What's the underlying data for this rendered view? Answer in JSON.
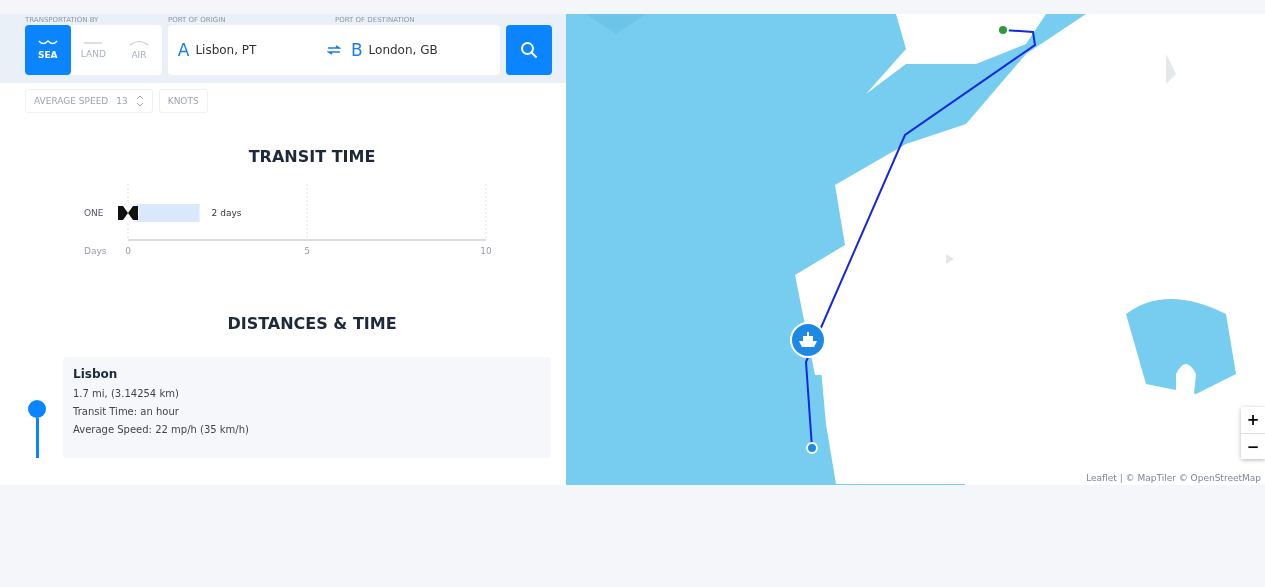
{
  "search": {
    "labels": [
      "TRANSPORTATION BY",
      "PORT OF ORIGIN",
      "PORT OF DESTINATION"
    ],
    "modes": [
      {
        "kind": "sea",
        "label": "SEA",
        "selected": true
      },
      {
        "kind": "land",
        "label": "LAND",
        "selected": false
      },
      {
        "kind": "air",
        "label": "AIR",
        "selected": false
      }
    ],
    "origin": {
      "letter": "A",
      "value": "Lisbon, PT"
    },
    "destination": {
      "letter": "B",
      "value": "London, GB"
    }
  },
  "speed": {
    "label": "AVERAGE SPEED",
    "value": "13",
    "unit": "KNOTS"
  },
  "transit_time": {
    "title": "TRANSIT TIME",
    "chart_data": {
      "type": "bar",
      "orientation": "horizontal",
      "categories": [
        "ONE"
      ],
      "values": [
        2
      ],
      "xlabel": "Days",
      "xlim": [
        0,
        10
      ],
      "xticks": [
        0,
        5,
        10
      ],
      "value_labels": [
        "2 days"
      ]
    }
  },
  "distances": {
    "title": "DISTANCES & TIME",
    "stops": [
      {
        "name": "Lisbon",
        "distance": "1.7 mi, (3.14254 km)",
        "transit": "Transit Time: an hour",
        "speed": "Average Speed: 22 mp/h (35 km/h)"
      }
    ]
  },
  "map": {
    "kind": "picture",
    "zoom_in": "+",
    "zoom_out": "−",
    "attribution": "Leaflet | © MapTiler © OpenStreetMap"
  }
}
